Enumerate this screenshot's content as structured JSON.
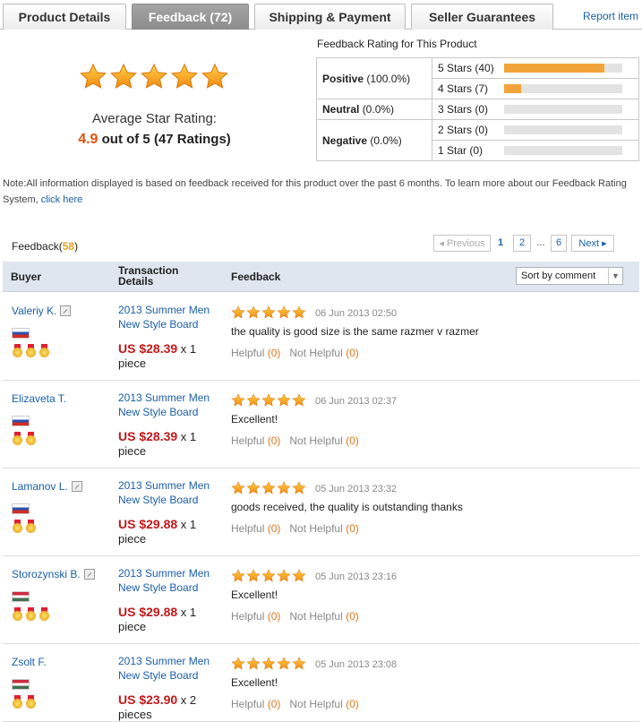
{
  "tabs": [
    {
      "label": "Product Details"
    },
    {
      "label": "Feedback (72)"
    },
    {
      "label": "Shipping & Payment"
    },
    {
      "label": "Seller Guarantees"
    }
  ],
  "report_link": "Report item",
  "summary": {
    "stars_filled": 5,
    "avg_label": "Average Star Rating:",
    "avg_value": "4.9",
    "avg_rest": " out of 5 (47 Ratings)"
  },
  "rating_table": {
    "title": "Feedback Rating for This Product",
    "categories": [
      {
        "label": "Positive",
        "pct": "(100.0%)"
      },
      {
        "label": "Neutral",
        "pct": "(0.0%)"
      },
      {
        "label": "Negative",
        "pct": "(0.0%)"
      }
    ],
    "stars": [
      {
        "label": "5 Stars (40)",
        "fraction": 0.85
      },
      {
        "label": "4 Stars (7)",
        "fraction": 0.15
      },
      {
        "label": "3 Stars (0)",
        "fraction": 0
      },
      {
        "label": "2 Stars (0)",
        "fraction": 0
      },
      {
        "label": "1 Star (0)",
        "fraction": 0
      }
    ]
  },
  "note": {
    "text": "Note:All information displayed is based on feedback received for this product over the past 6 months. To learn more about our Feedback Rating System, ",
    "link": "click here"
  },
  "feedback_header": {
    "label": "Feedback(",
    "count": "58",
    "close": ")"
  },
  "pager": {
    "prev": "◂ Previous",
    "pages": [
      "1",
      "2",
      "...",
      "6"
    ],
    "next": "Next ▸"
  },
  "table_header": {
    "buyer": "Buyer",
    "transaction": "Transaction Details",
    "feedback": "Feedback",
    "sort": "Sort by comment"
  },
  "rows": [
    {
      "buyer": "Valeriy K.",
      "verified": true,
      "flag": "ru",
      "medals": 3,
      "product": "2013 Summer Men New Style Board",
      "price": "US $28.39",
      "qty": " x 1",
      "unit": "piece",
      "stars": 5,
      "date": "06 Jun 2013 02:50",
      "comment": "the quality is good size is the same razmer v razmer",
      "helpful": "Helpful",
      "helpful_count": "(0)",
      "not_helpful": "Not Helpful",
      "not_helpful_count": "(0)"
    },
    {
      "buyer": "Elizaveta T.",
      "verified": false,
      "flag": "ru",
      "medals": 2,
      "product": "2013 Summer Men New Style Board",
      "price": "US $28.39",
      "qty": " x 1",
      "unit": "piece",
      "stars": 5,
      "date": "06 Jun 2013 02:37",
      "comment": "Excellent!",
      "helpful": "Helpful",
      "helpful_count": "(0)",
      "not_helpful": "Not Helpful",
      "not_helpful_count": "(0)"
    },
    {
      "buyer": "Lamanov L.",
      "verified": true,
      "flag": "ru",
      "medals": 2,
      "product": "2013 Summer Men New Style Board",
      "price": "US $29.88",
      "qty": " x 1",
      "unit": "piece",
      "stars": 5,
      "date": "05 Jun 2013 23:32",
      "comment": "goods received, the quality is outstanding thanks",
      "helpful": "Helpful",
      "helpful_count": "(0)",
      "not_helpful": "Not Helpful",
      "not_helpful_count": "(0)"
    },
    {
      "buyer": "Storozynski B.",
      "verified": true,
      "flag": "hu",
      "medals": 3,
      "product": "2013 Summer Men New Style Board",
      "price": "US $29.88",
      "qty": " x 1",
      "unit": "piece",
      "stars": 5,
      "date": "05 Jun 2013 23:16",
      "comment": "Excellent!",
      "helpful": "Helpful",
      "helpful_count": "(0)",
      "not_helpful": "Not Helpful",
      "not_helpful_count": "(0)"
    },
    {
      "buyer": "Zsolt F.",
      "verified": false,
      "flag": "hu",
      "medals": 2,
      "product": "2013 Summer Men New Style Board",
      "price": "US $23.90",
      "qty": " x 2",
      "unit": "pieces",
      "stars": 5,
      "date": "05 Jun 2013 23:08",
      "comment": "Excellent!",
      "helpful": "Helpful",
      "helpful_count": "(0)",
      "not_helpful": "Not Helpful",
      "not_helpful_count": "(0)"
    }
  ]
}
